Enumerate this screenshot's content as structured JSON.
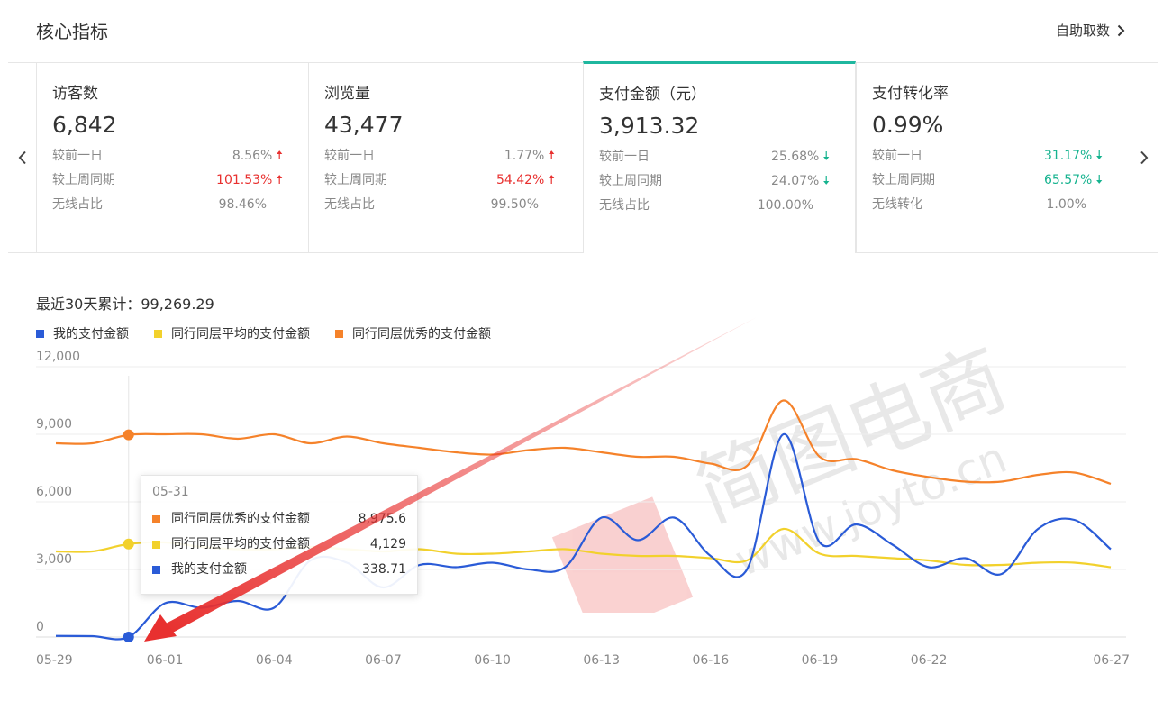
{
  "header": {
    "title": "核心指标",
    "custom_label": "自助取数"
  },
  "cards": [
    {
      "title": "访客数",
      "value": "6,842",
      "rows": [
        {
          "label": "较前一日",
          "value": "8.56%",
          "trend": "up"
        },
        {
          "label": "较上周同期",
          "value": "101.53%",
          "trend": "up"
        },
        {
          "label": "无线占比",
          "value": "98.46%",
          "trend": "none"
        }
      ]
    },
    {
      "title": "浏览量",
      "value": "43,477",
      "rows": [
        {
          "label": "较前一日",
          "value": "1.77%",
          "trend": "up"
        },
        {
          "label": "较上周同期",
          "value": "54.42%",
          "trend": "up"
        },
        {
          "label": "无线占比",
          "value": "99.50%",
          "trend": "none"
        }
      ]
    },
    {
      "title": "支付金额（元）",
      "value": "3,913.32",
      "rows": [
        {
          "label": "较前一日",
          "value": "25.68%",
          "trend": "down"
        },
        {
          "label": "较上周同期",
          "value": "24.07%",
          "trend": "down"
        },
        {
          "label": "无线占比",
          "value": "100.00%",
          "trend": "none"
        }
      ]
    },
    {
      "title": "支付转化率",
      "value": "0.99%",
      "rows": [
        {
          "label": "较前一日",
          "value": "31.17%",
          "trend": "down"
        },
        {
          "label": "较上周同期",
          "value": "65.57%",
          "trend": "down"
        },
        {
          "label": "无线转化",
          "value": "1.00%",
          "trend": "none"
        }
      ]
    }
  ],
  "summary": {
    "text": "最近30天累计：99,269.29"
  },
  "colors": {
    "up": "#e8302f",
    "down": "#16b38f",
    "accent": "#1fb79f"
  },
  "chart_data": {
    "type": "line",
    "x": [
      "05-29",
      "05-30",
      "05-31",
      "06-01",
      "06-02",
      "06-03",
      "06-04",
      "06-05",
      "06-06",
      "06-07",
      "06-08",
      "06-09",
      "06-10",
      "06-11",
      "06-12",
      "06-13",
      "06-14",
      "06-15",
      "06-16",
      "06-17",
      "06-18",
      "06-19",
      "06-20",
      "06-21",
      "06-22",
      "06-23",
      "06-24",
      "06-25",
      "06-26",
      "06-27"
    ],
    "xticks": [
      "05-29",
      "06-01",
      "06-04",
      "06-07",
      "06-10",
      "06-13",
      "06-16",
      "06-19",
      "06-22",
      "06-27"
    ],
    "ylim": [
      0,
      12000
    ],
    "yticks": [
      "12,000",
      "9,000",
      "6,000",
      "3,000",
      "0"
    ],
    "series": [
      {
        "name": "我的支付金额",
        "color": "#2a5bd7",
        "values": [
          50,
          40,
          0,
          1500,
          1300,
          1600,
          1300,
          3400,
          3300,
          2200,
          3200,
          3100,
          3300,
          3000,
          3100,
          5300,
          4300,
          5300,
          3600,
          3000,
          9000,
          4200,
          5000,
          4100,
          3100,
          3500,
          2800,
          4800,
          5200,
          3900
        ]
      },
      {
        "name": "同行同层平均的支付金额",
        "color": "#f2d12c",
        "values": [
          3800,
          3800,
          4129,
          4200,
          4000,
          3900,
          3900,
          4000,
          3900,
          3800,
          3900,
          3700,
          3700,
          3800,
          3900,
          3700,
          3600,
          3600,
          3500,
          3400,
          4800,
          3700,
          3600,
          3500,
          3400,
          3200,
          3200,
          3300,
          3300,
          3100
        ]
      },
      {
        "name": "同行同层优秀的支付金额",
        "color": "#f5822a",
        "values": [
          8600,
          8600,
          8975.6,
          9000,
          9000,
          8800,
          9000,
          8600,
          8900,
          8600,
          8400,
          8200,
          8100,
          8300,
          8400,
          8200,
          8000,
          8000,
          7700,
          7600,
          10500,
          8000,
          7900,
          7400,
          7100,
          6900,
          6900,
          7200,
          7300,
          6800
        ]
      }
    ],
    "tooltip": {
      "date": "05-31",
      "rows": [
        {
          "name": "同行同层优秀的支付金额",
          "value": "8,975.6",
          "color": "#f5822a"
        },
        {
          "name": "同行同层平均的支付金额",
          "value": "4,129",
          "color": "#f2d12c"
        },
        {
          "name": "我的支付金额",
          "value": "338.71",
          "color": "#2a5bd7"
        }
      ]
    }
  },
  "watermark": {
    "text": "简图电商",
    "url": "www.joyto.cn"
  }
}
